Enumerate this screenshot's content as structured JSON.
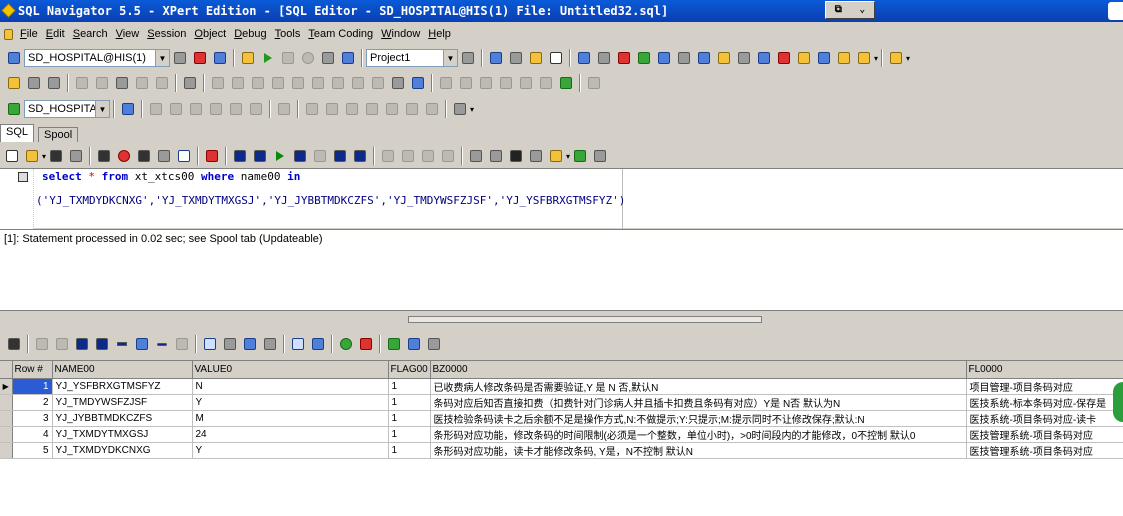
{
  "window": {
    "title": "SQL Navigator 5.5 - XPert Edition - [SQL Editor - SD_HOSPITAL@HIS(1) File: Untitled32.sql]"
  },
  "menu": [
    "File",
    "Edit",
    "Search",
    "View",
    "Session",
    "Object",
    "Debug",
    "Tools",
    "Team Coding",
    "Window",
    "Help"
  ],
  "toolbar": {
    "session_combo": "SD_HOSPITAL@HIS(1)",
    "project_combo": "Project1",
    "schema_combo": "SD_HOSPITAL"
  },
  "tabs": [
    {
      "label": "SQL",
      "active": true
    },
    {
      "label": "Spool",
      "active": false
    }
  ],
  "editor": {
    "line1": {
      "kw_select": "select",
      "star": "*",
      "kw_from": "from",
      "table": "xt_xtcs00",
      "kw_where": "where",
      "column": "name00",
      "kw_in": "in"
    },
    "line2": "('YJ_TXMDYDKCNXG','YJ_TXMDYTMXGSJ','YJ_JYBBTMDKCZFS','YJ_TMDYWSFZJSF','YJ_YSFBRXGTMSFYZ')"
  },
  "status_message": "[1]: Statement processed in 0.02 sec; see Spool tab (Updateable)",
  "grid": {
    "columns": [
      "Row #",
      "NAME00",
      "VALUE0",
      "FLAG00",
      "BZ0000",
      "FL0000"
    ],
    "rows": [
      {
        "row": "1",
        "name": "YJ_YSFBRXGTMSFYZ",
        "value": "N",
        "flag": "1",
        "bz": "已收费病人修改条码是否需要验证,Y 是 N 否,默认N",
        "fl": "项目管理-项目条码对应"
      },
      {
        "row": "2",
        "name": "YJ_TMDYWSFZJSF",
        "value": "Y",
        "flag": "1",
        "bz": "条码对应后知否直接扣费（扣费针对门诊病人并且插卡扣费且条码有对应）Y是 N否 默认为N",
        "fl": "医技系统-标本条码对应-保存是"
      },
      {
        "row": "3",
        "name": "YJ_JYBBTMDKCZFS",
        "value": "M",
        "flag": "1",
        "bz": "医技检验条码读卡之后余额不足是操作方式,N:不做提示;Y:只提示;M:提示同时不让修改保存;默认:N",
        "fl": "医技系统-项目条码对应-读卡"
      },
      {
        "row": "4",
        "name": "YJ_TXMDYTMXGSJ",
        "value": "24",
        "flag": "1",
        "bz": "条形码对应功能，修改条码的时间限制(必须是一个整数，单位小时)，>0时间段内的才能修改，0不控制 默认0",
        "fl": "医技管理系统-项目条码对应"
      },
      {
        "row": "5",
        "name": "YJ_TXMDYDKCNXG",
        "value": "Y",
        "flag": "1",
        "bz": "条形码对应功能，读卡才能修改条码, Y是，N不控制 默认N",
        "fl": "医技管理系统-项目条码对应"
      }
    ]
  }
}
